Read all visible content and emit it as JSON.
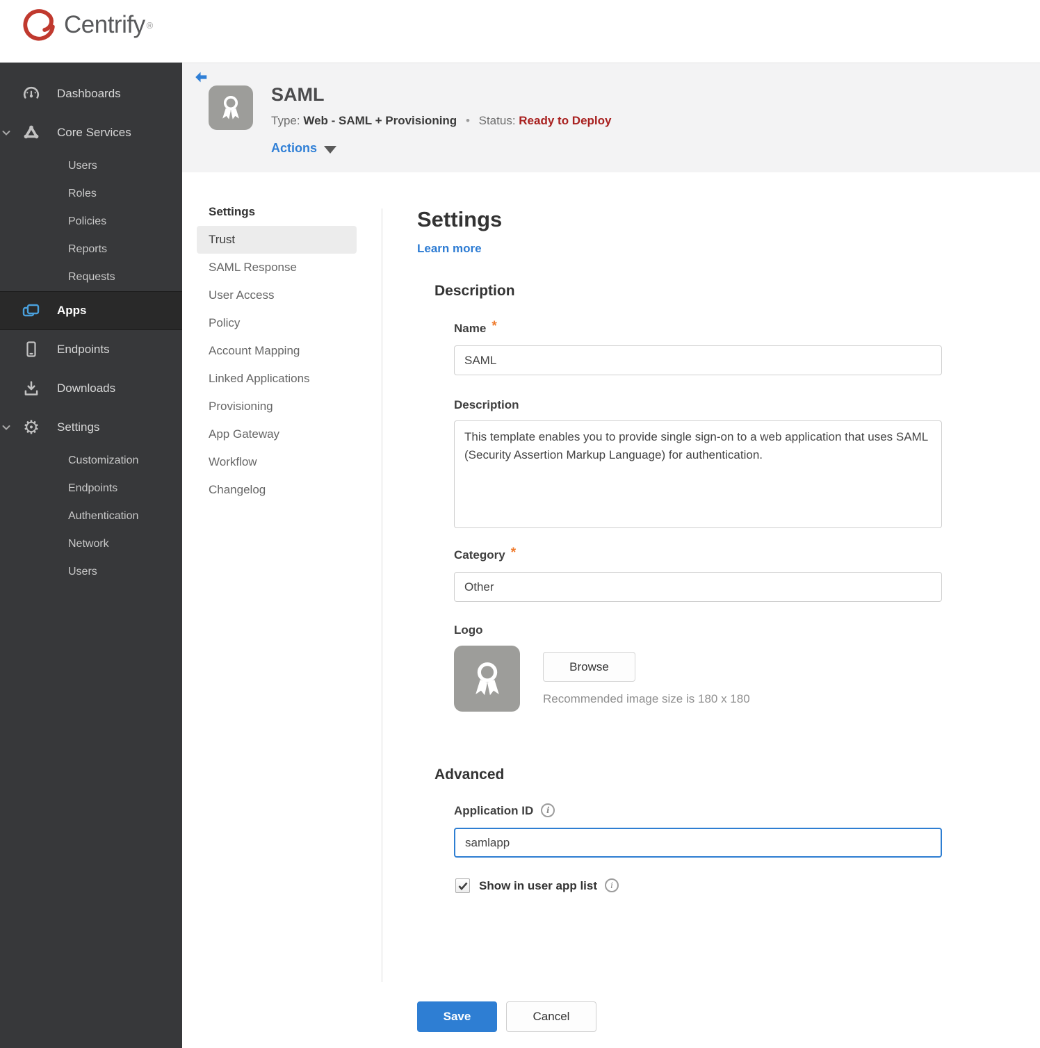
{
  "brand": {
    "name": "Centrify",
    "trademark": "®"
  },
  "ui": {
    "gear_glyph": "⚙"
  },
  "sidebar": {
    "items": [
      {
        "label": "Dashboards",
        "icon": "gauge-icon",
        "type": "top"
      },
      {
        "label": "Core Services",
        "icon": "core-services-icon",
        "type": "top",
        "expanded": true
      },
      {
        "label": "Users",
        "type": "sub"
      },
      {
        "label": "Roles",
        "type": "sub"
      },
      {
        "label": "Policies",
        "type": "sub"
      },
      {
        "label": "Reports",
        "type": "sub"
      },
      {
        "label": "Requests",
        "type": "sub"
      },
      {
        "label": "Apps",
        "icon": "apps-icon",
        "type": "top",
        "selected": true
      },
      {
        "label": "Endpoints",
        "icon": "phone-icon",
        "type": "top"
      },
      {
        "label": "Downloads",
        "icon": "download-icon",
        "type": "top"
      },
      {
        "label": "Settings",
        "icon": "gear-icon",
        "type": "top",
        "expanded": true
      },
      {
        "label": "Customization",
        "type": "sub"
      },
      {
        "label": "Endpoints",
        "type": "sub"
      },
      {
        "label": "Authentication",
        "type": "sub"
      },
      {
        "label": "Network",
        "type": "sub"
      },
      {
        "label": "Users",
        "type": "sub"
      }
    ]
  },
  "app_header": {
    "icon": "award-ribbon-icon",
    "title": "SAML",
    "type_label": "Type:",
    "type_value": "Web - SAML + Provisioning",
    "separator": "•",
    "status_label": "Status:",
    "status_value": "Ready to Deploy",
    "actions_label": "Actions"
  },
  "subnav": {
    "heading": "Settings",
    "selected": "Trust",
    "items": [
      "Trust",
      "SAML Response",
      "User Access",
      "Policy",
      "Account Mapping",
      "Linked Applications",
      "Provisioning",
      "App Gateway",
      "Workflow",
      "Changelog"
    ]
  },
  "main": {
    "title": "Settings",
    "learn_more_label": "Learn more",
    "required_marker": "*",
    "description": {
      "heading": "Description",
      "name_label": "Name",
      "name_value": "SAML",
      "description_label": "Description",
      "description_value": "This template enables you to provide single sign-on to a web application that uses SAML (Security Assertion Markup Language) for authentication.",
      "category_label": "Category",
      "category_value": "Other",
      "logo_label": "Logo",
      "logo_icon": "award-ribbon-icon",
      "browse_label": "Browse",
      "logo_note": "Recommended image size is 180 x 180"
    },
    "advanced": {
      "heading": "Advanced",
      "application_id_label": "Application ID",
      "application_id_value": "samlapp",
      "show_in_user_app_list_label": "Show in user app list",
      "show_in_user_app_list_checked": true
    },
    "buttons": {
      "save_label": "Save",
      "cancel_label": "Cancel"
    }
  },
  "colors": {
    "accent_blue": "#2e7ed3",
    "link_blue": "#2c7bd3",
    "status_red": "#a8201f",
    "required_orange": "#ef7b2d",
    "sidebar_bg": "#37383a",
    "sidebar_selected_bg": "#292929",
    "apps_icon_blue": "#4aa0dc",
    "header_band_bg": "#f3f3f4",
    "logo_gray": "#9d9d9a"
  }
}
